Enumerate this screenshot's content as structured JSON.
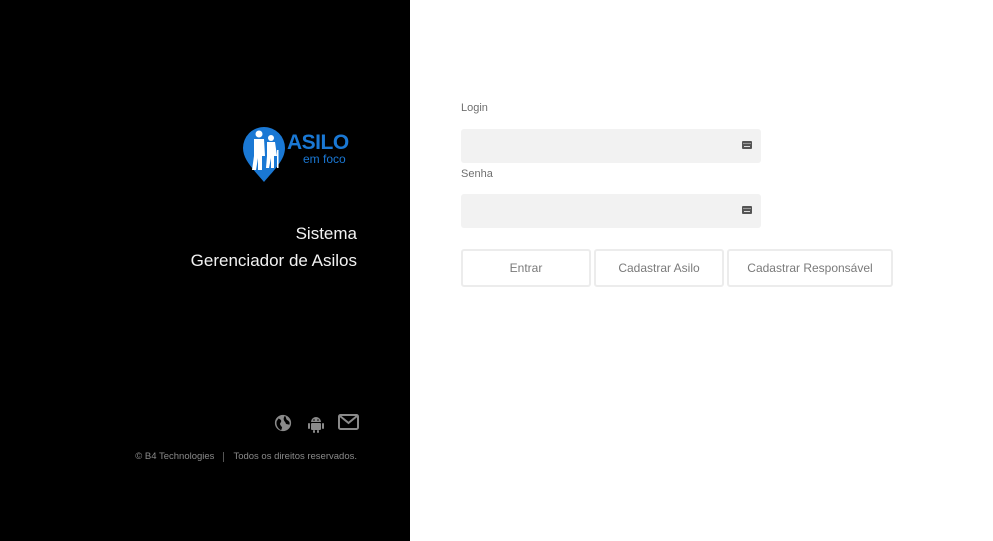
{
  "brand": {
    "logo_word": "ASILO",
    "logo_sub": "em foco",
    "tagline_line1": "Sistema",
    "tagline_line2": "Gerenciador de Asilos",
    "logo_color": "#1a78d4"
  },
  "social": {
    "icons": [
      "globe-icon",
      "android-icon",
      "mail-icon"
    ],
    "icon_color": "#8a8a8a"
  },
  "footer": {
    "company": "© B4 Technologies",
    "rights": "Todos os direitos reservados."
  },
  "form": {
    "login_label": "Login",
    "login_value": "",
    "senha_label": "Senha",
    "senha_value": "",
    "buttons": {
      "entrar": "Entrar",
      "cadastrar_asilo": "Cadastrar Asilo",
      "cadastrar_responsavel": "Cadastrar Responsável"
    }
  },
  "colors": {
    "left_panel_bg": "#000000",
    "field_bg": "#f2f2f2"
  }
}
